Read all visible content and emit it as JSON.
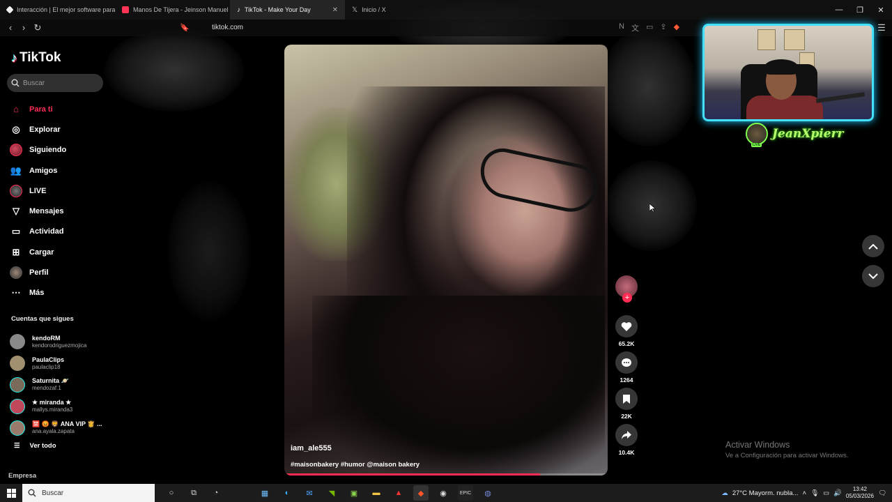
{
  "browser": {
    "tabs": [
      {
        "title": "Interacción | El mejor software para",
        "active": false,
        "color": "#f1f1f1"
      },
      {
        "title": "Manos De Tijera - Jeinson Manuel y",
        "active": false,
        "color": "#ff3355"
      },
      {
        "title": "TikTok - Make Your Day",
        "active": true,
        "color": "#ffffff"
      },
      {
        "title": "Inicio / X",
        "active": false,
        "color": "#ffffff"
      }
    ],
    "url": "tiktok.com"
  },
  "sidebar": {
    "logo": "TikTok",
    "search_placeholder": "Buscar",
    "menu": [
      {
        "label": "Para ti",
        "icon": "home-icon",
        "active": true
      },
      {
        "label": "Explorar",
        "icon": "compass-icon",
        "active": false
      },
      {
        "label": "Siguiendo",
        "icon": "following-avatar-icon",
        "active": false
      },
      {
        "label": "Amigos",
        "icon": "friends-icon",
        "active": false
      },
      {
        "label": "LIVE",
        "icon": "live-avatar-icon",
        "active": false
      },
      {
        "label": "Mensajes",
        "icon": "messages-icon",
        "active": false
      },
      {
        "label": "Actividad",
        "icon": "activity-icon",
        "active": false
      },
      {
        "label": "Cargar",
        "icon": "upload-icon",
        "active": false
      },
      {
        "label": "Perfil",
        "icon": "profile-icon",
        "active": false
      },
      {
        "label": "Más",
        "icon": "more-icon",
        "active": false
      }
    ],
    "following_title": "Cuentas que sigues",
    "following": [
      {
        "name": "kendoRM",
        "handle": "kendorodriguezmojica",
        "color": "#8a8a8a"
      },
      {
        "name": "PaulaClips",
        "handle": "paulaclip18",
        "color": "#a09070"
      },
      {
        "name": "Saturnita 🪐",
        "handle": "mendozaf.1",
        "color": "#7a6a5a"
      },
      {
        "name": "★ miranda ★",
        "handle": "mallys.miranda3",
        "color": "#c0485a"
      },
      {
        "name": "🈲 😡 🦁 ANA VIP 👸 ...",
        "handle": "ana.ayala.zapata",
        "color": "#9a7a6a"
      }
    ],
    "see_all": "Ver todo",
    "footer": "Empresa"
  },
  "video": {
    "username": "iam_ale555",
    "caption": "#maisonbakery #humor @maison bakery",
    "progress": 0.79
  },
  "actions": {
    "likes": "65.2K",
    "comments": "1264",
    "saves": "22K",
    "shares": "10.4K"
  },
  "stream": {
    "streamer": "JeanXpierr",
    "live_badge": "LIVE"
  },
  "watermark": {
    "line1": "Activar Windows",
    "line2": "Ve a Configuración para activar Windows."
  },
  "taskbar": {
    "search": "Buscar",
    "weather": "27°C  Mayorm. nubla...",
    "time": "13:42",
    "date": "05/03/2026"
  },
  "colors": {
    "accent": "#fe2c55",
    "cam_border": "#43e0ff",
    "streamer_name": "#b6ff6a"
  }
}
